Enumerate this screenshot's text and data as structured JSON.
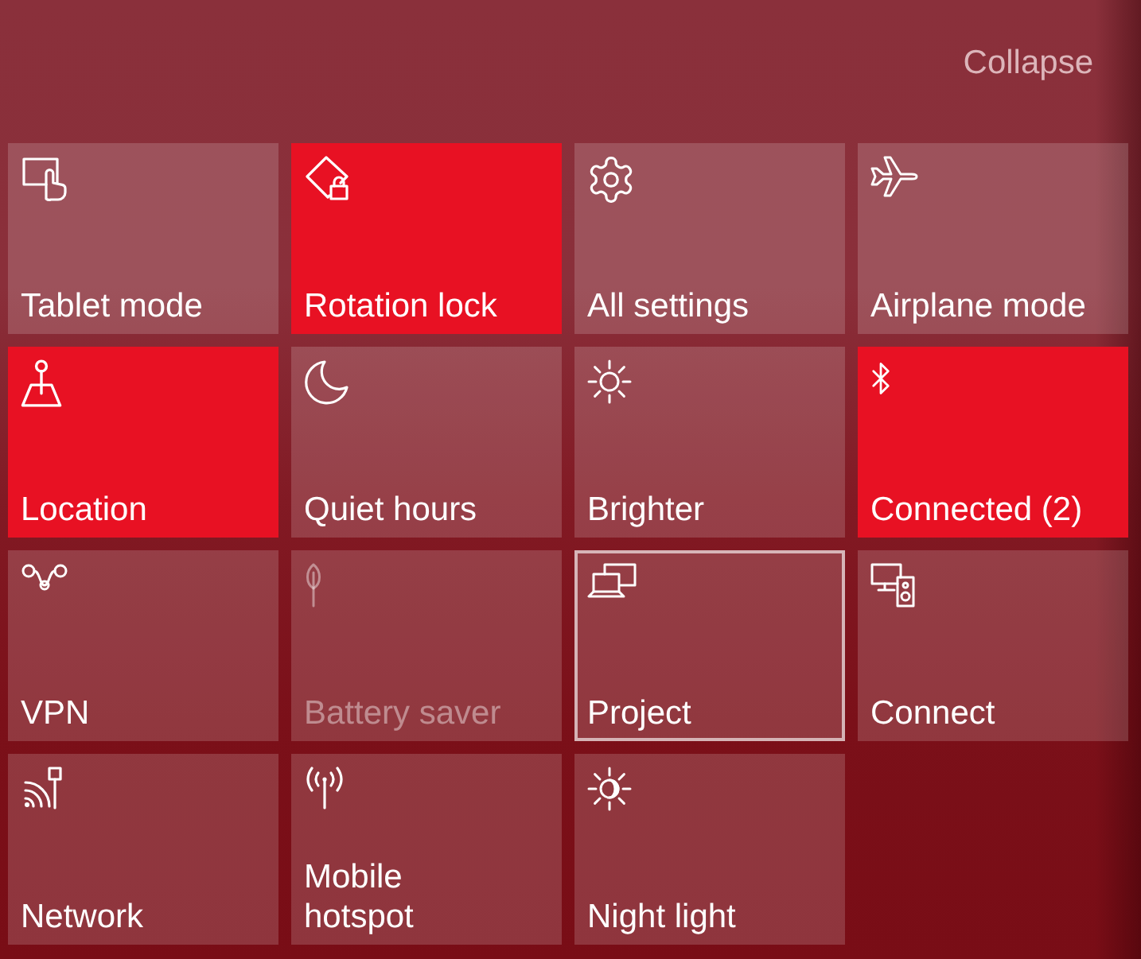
{
  "header": {
    "collapse_label": "Collapse"
  },
  "tiles": [
    {
      "label": "Tablet mode",
      "on": false,
      "disabled": false,
      "focused": false
    },
    {
      "label": "Rotation lock",
      "on": true,
      "disabled": false,
      "focused": false
    },
    {
      "label": "All settings",
      "on": false,
      "disabled": false,
      "focused": false
    },
    {
      "label": "Airplane mode",
      "on": false,
      "disabled": false,
      "focused": false
    },
    {
      "label": "Location",
      "on": true,
      "disabled": false,
      "focused": false
    },
    {
      "label": "Quiet hours",
      "on": false,
      "disabled": false,
      "focused": false
    },
    {
      "label": "Brighter",
      "on": false,
      "disabled": false,
      "focused": false
    },
    {
      "label": "Connected (2)",
      "on": true,
      "disabled": false,
      "focused": false
    },
    {
      "label": "VPN",
      "on": false,
      "disabled": false,
      "focused": false
    },
    {
      "label": "Battery saver",
      "on": false,
      "disabled": true,
      "focused": false
    },
    {
      "label": "Project",
      "on": false,
      "disabled": false,
      "focused": true
    },
    {
      "label": "Connect",
      "on": false,
      "disabled": false,
      "focused": false
    },
    {
      "label": "Network",
      "on": false,
      "disabled": false,
      "focused": false
    },
    {
      "label": "Mobile\nhotspot",
      "on": false,
      "disabled": false,
      "focused": false
    },
    {
      "label": "Night light",
      "on": false,
      "disabled": false,
      "focused": false
    }
  ]
}
